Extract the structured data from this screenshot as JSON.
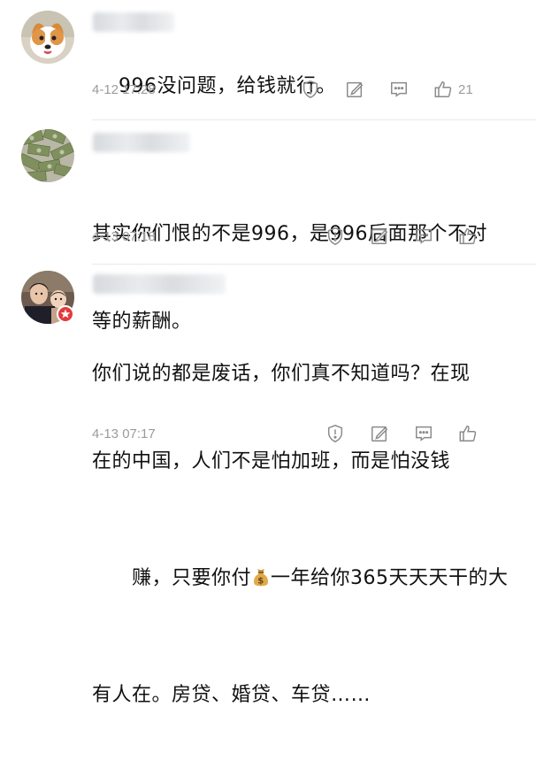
{
  "comments": [
    {
      "text": "996没问题，给钱就行。",
      "time": "4-12 17:28",
      "likes": "21"
    },
    {
      "text_line1": "其实你们恨的不是996，是996后面那个不对",
      "text_line2": "等的薪酬。",
      "time": "4-13 07:18",
      "likes": ""
    },
    {
      "text_line1": "你们说的都是废话，你们真不知道吗？在现",
      "text_line2": "在的中国，人们不是怕加班，而是怕没钱",
      "text_line3_a": "赚，只要你付",
      "text_line3_b": "一年给你365天天天干的大",
      "text_line4": "有人在。房贷、婚贷、车贷……",
      "time": "4-13 07:17",
      "likes": ""
    }
  ],
  "icons": {
    "report": "shield-alert-icon",
    "share": "edit-square-icon",
    "reply": "comment-bubble-icon",
    "like": "thumbs-up-icon",
    "money": "money-bag-icon",
    "badge": "red-verification-badge"
  },
  "colors": {
    "text": "#111111",
    "meta": "#9b9b9b",
    "icon": "#8a8a8a",
    "badge": "#e23b3b"
  }
}
